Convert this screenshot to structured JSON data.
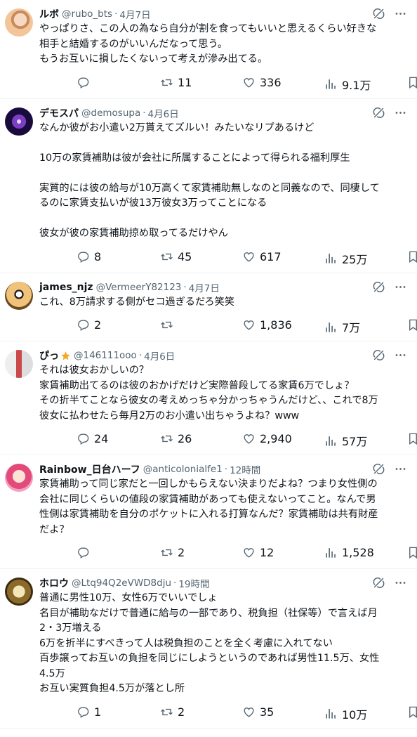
{
  "colors": {
    "text": "#0f1419",
    "secondary": "#536471",
    "border": "#eff3f4",
    "star": "#f5a623"
  },
  "tweets": [
    {
      "name": "ルボ",
      "handle": "@rubo_bts",
      "time": "4月7日",
      "badge": "",
      "lines": [
        "やっぱりさ、この人の為なら自分が割を食ってもいいと思えるくらい好きな",
        "相手と結婚するのがいいんだなって思う。",
        "もうお互いに損したくないって考えが滲み出てる。"
      ],
      "replies": "",
      "retweets": "11",
      "likes": "336",
      "views": "9.1万"
    },
    {
      "name": "デモスパ",
      "handle": "@demosupa",
      "time": "4月6日",
      "badge": "",
      "lines": [
        "なんか彼がお小遣い2万貰えてズルい！みたいなリプあるけど",
        "",
        "10万の家賃補助は彼が会社に所属することによって得られる福利厚生",
        "",
        "実質的には彼の給与が10万高くて家賃補助無しなのと同義なので、同棲して",
        "るのに家賃支払いが彼13万彼女3万ってことになる",
        "",
        "彼女が彼の家賃補助掠め取ってるだけやん"
      ],
      "replies": "8",
      "retweets": "45",
      "likes": "617",
      "views": "25万"
    },
    {
      "name": "james_njz",
      "handle": "@VermeerY82123",
      "time": "4月7日",
      "badge": "",
      "lines": [
        "これ、8万請求する側がセコ過ぎるだろ笑笑"
      ],
      "replies": "2",
      "retweets": "",
      "likes": "1,836",
      "views": "7万"
    },
    {
      "name": "ぴっ",
      "handle": "@146111ooo",
      "time": "4月6日",
      "badge": "star",
      "lines": [
        "それは彼女おかしいの？",
        "家賃補助出てるのは彼のおかげだけど実際普段してる家賃6万でしょ？",
        "その折半てことなら彼女の考えめっちゃ分かっちゃうんだけど、、これで8万",
        "彼女に払わせたら毎月2万のお小遣い出ちゃうよね？www"
      ],
      "replies": "24",
      "retweets": "26",
      "likes": "2,940",
      "views": "57万"
    },
    {
      "name": "Rainbow_日台ハーフ",
      "handle": "@anticolonialfe1",
      "time": "12時間",
      "badge": "",
      "lines": [
        "家賃補助って同じ家だと一回しかもらえない決まりだよね？つまり女性側の",
        "会社に同じくらいの値段の家賃補助があっても使えないってこと。なんで男",
        "性側は家賃補助を自分のポケットに入れる打算なんだ？家賃補助は共有財産",
        "だよ？"
      ],
      "replies": "",
      "retweets": "2",
      "likes": "12",
      "views": "1,528"
    },
    {
      "name": "ホロウ",
      "handle": "@Ltq94Q2eVWD8dju",
      "time": "19時間",
      "badge": "",
      "lines": [
        "普通に男性10万、女性6万でいいでしょ",
        "名目が補助なだけで普通に給与の一部であり、税負担（社保等）で言えば月",
        "2・3万増える",
        "6万を折半にすべきって人は税負担のことを全く考慮に入れてない",
        "百歩譲ってお互いの負担を同じにしようというのであれば男性11.5万、女性",
        "4.5万",
        "お互い実質負担4.5万が落とし所"
      ],
      "replies": "1",
      "retweets": "2",
      "likes": "35",
      "views": "10万"
    }
  ]
}
